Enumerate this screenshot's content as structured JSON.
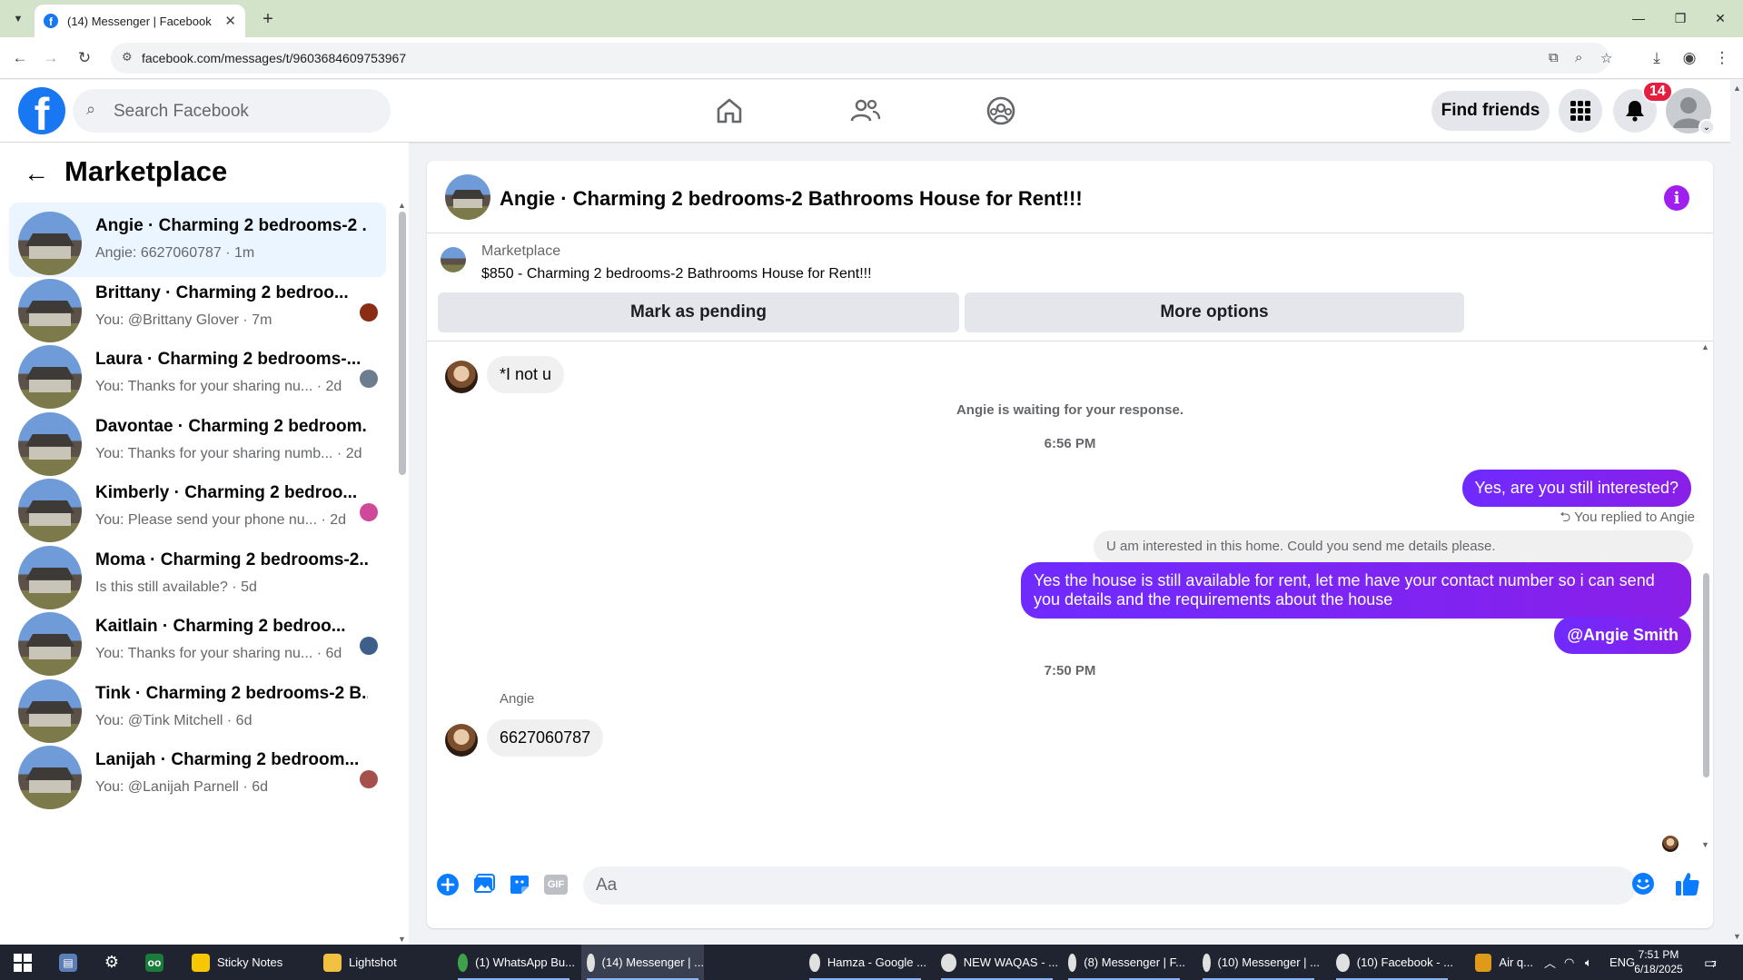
{
  "browser": {
    "tab_title": "(14) Messenger | Facebook",
    "url": "facebook.com/messages/t/9603684609753967"
  },
  "fb_header": {
    "logo_letter": "f",
    "search_placeholder": "Search Facebook",
    "find_friends_label": "Find friends",
    "notification_count": "14"
  },
  "left_panel": {
    "title": "Marketplace",
    "chats": [
      {
        "name": "Angie · Charming 2 bedrooms-2 ...",
        "subtitle": "Angie: 6627060787 · 1m",
        "active": true,
        "mini_color": ""
      },
      {
        "name": "Brittany · Charming 2 bedroo...",
        "subtitle": "You: @Brittany Glover · 7m",
        "active": false,
        "mini_color": "#8b2c14"
      },
      {
        "name": "Laura · Charming 2 bedrooms-...",
        "subtitle": "You: Thanks for your sharing nu... · 2d",
        "active": false,
        "mini_color": "#6b7d8f"
      },
      {
        "name": "Davontae · Charming 2 bedroom...",
        "subtitle": "You: Thanks for your sharing numb... · 2d",
        "active": false,
        "mini_color": ""
      },
      {
        "name": "Kimberly · Charming 2 bedroo...",
        "subtitle": "You: Please send your phone nu... · 2d",
        "active": false,
        "mini_color": "#d0489a"
      },
      {
        "name": "Moma · Charming 2 bedrooms-2...",
        "subtitle": "Is this still available? · 5d",
        "active": false,
        "mini_color": ""
      },
      {
        "name": "Kaitlain · Charming 2 bedroo...",
        "subtitle": "You: Thanks for your sharing nu... · 6d",
        "active": false,
        "mini_color": "#3e5f8a"
      },
      {
        "name": "Tink · Charming 2 bedrooms-2 B...",
        "subtitle": "You: @Tink Mitchell · 6d",
        "active": false,
        "mini_color": ""
      },
      {
        "name": "Lanijah · Charming 2 bedroom...",
        "subtitle": "You: @Lanijah Parnell · 6d",
        "active": false,
        "mini_color": "#a5504a"
      }
    ]
  },
  "conversation": {
    "title": "Angie · Charming 2 bedrooms-2 Bathrooms House for Rent!!!",
    "listing_label": "Marketplace",
    "listing_title": "$850 - Charming 2 bedrooms-2 Bathrooms House for Rent!!!",
    "mark_pending_label": "Mark as pending",
    "more_options_label": "More options",
    "messages": {
      "incoming_1": "*I not u",
      "waiting_notice": "Angie is waiting for your response.",
      "time_1": "6:56 PM",
      "outgoing_1": "Yes, are you still interested?",
      "replied_note": "You replied to Angie",
      "quoted": "U am interested in this home. Could you send me details please.",
      "outgoing_2": "Yes the house is still available for rent, let me have your contact number so i can send you details and the requirements about the house",
      "outgoing_3": "@Angie Smith",
      "time_2": "7:50 PM",
      "sender_name": "Angie",
      "incoming_2": "6627060787"
    },
    "composer_placeholder": "Aa",
    "gif_label": "GIF"
  },
  "taskbar": {
    "items": [
      {
        "label": "Sticky Notes"
      },
      {
        "label": "Lightshot"
      },
      {
        "label": "(1) WhatsApp Bu..."
      },
      {
        "label": "(14) Messenger | ..."
      },
      {
        "label": "Hamza - Google ..."
      },
      {
        "label": "NEW WAQAS - ..."
      },
      {
        "label": "(8) Messenger | F..."
      },
      {
        "label": "(10) Messenger | ..."
      },
      {
        "label": "(10) Facebook - ..."
      },
      {
        "label": "Air q..."
      }
    ],
    "lang": "ENG",
    "time": "7:51 PM",
    "date": "6/18/2025",
    "notif_count": "7"
  },
  "colors": {
    "fb_blue": "#1877f2",
    "messenger_purple": "#7a24ff",
    "badge_red": "#e41e3f",
    "tab_strip": "#d3e3c9"
  }
}
